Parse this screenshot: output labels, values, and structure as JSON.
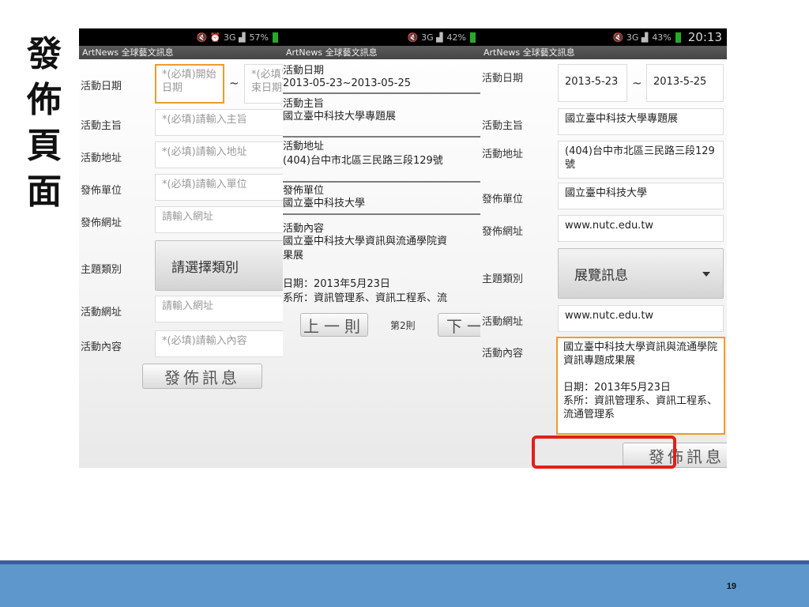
{
  "slide": {
    "side_title": [
      "發",
      "佈",
      "頁",
      "面"
    ],
    "page_number": "19"
  },
  "colors": {
    "focus_border": "#f39a2b",
    "highlight": "#e0201b",
    "footer": "#5d97cc"
  },
  "screen1": {
    "status": {
      "icons": "🔇 ⏰ 3G ▟",
      "battery": "57%"
    },
    "app_title": "ArtNews 全球藝文訊息",
    "rows": {
      "date_label": "活動日期",
      "date_start_placeholder": "*(必填)開始日期",
      "date_separator": "~",
      "date_end_placeholder": "*(必填)結束日期",
      "subject_label": "活動主旨",
      "subject_placeholder": "*(必填)請輸入主旨",
      "address_label": "活動地址",
      "address_placeholder": "*(必填)請輸入地址",
      "unit_label": "發佈單位",
      "unit_placeholder": "*(必填)請輸入單位",
      "url_label": "發佈網址",
      "url_placeholder": "請輸入網址",
      "category_label": "主題類別",
      "category_value": "請選擇類別",
      "event_url_label": "活動網址",
      "event_url_placeholder": "請輸入網址",
      "content_label": "活動內容",
      "content_placeholder": "*(必填)請輸入內容"
    },
    "submit_label": "發佈訊息"
  },
  "screen2": {
    "status": {
      "icons": "🔇 3G ▟",
      "battery": "42%"
    },
    "app_title": "ArtNews 全球藝文訊息",
    "date_label": "活動日期",
    "date_value": "2013-05-23~2013-05-25",
    "subject_label": "活動主旨",
    "subject_value": "國立臺中科技大學專題展",
    "address_label": "活動地址",
    "address_value": "(404)台中市北區三民路三段129號",
    "unit_label": "發佈單位",
    "unit_value": "國立臺中科技大學",
    "content_label": "活動內容",
    "content_line1": "國立臺中科技大學資訊與流通學院資",
    "content_line2": "果展",
    "content_line3": "日期：2013年5月23日",
    "content_line4": "系所：資訊管理系、資訊工程系、流",
    "prev_label": "上一則",
    "page_label": "第2則",
    "next_label": "下一"
  },
  "screen3": {
    "status": {
      "icons": "🔇 3G ▟",
      "battery": "43%",
      "clock": "20:13"
    },
    "app_title": "ArtNews 全球藝文訊息",
    "date_label": "活動日期",
    "date_start": "2013-5-23",
    "date_separator": "~",
    "date_end": "2013-5-25",
    "subject_label": "活動主旨",
    "subject_value": "國立臺中科技大學專題展",
    "address_label": "活動地址",
    "address_value": "(404)台中市北區三民路三段129號",
    "unit_label": "發佈單位",
    "unit_value": "國立臺中科技大學",
    "url_label": "發佈網址",
    "url_value": "www.nutc.edu.tw",
    "category_label": "主題類別",
    "category_value": "展覽訊息",
    "event_url_label": "活動網址",
    "event_url_value": "www.nutc.edu.tw",
    "content_label": "活動內容",
    "content_value": "國立臺中科技大學資訊與流通學院資訊專題成果展\n\n日期：2013年5月23日\n系所：資訊管理系、資訊工程系、流通管理系",
    "submit_label": "發佈訊息"
  }
}
